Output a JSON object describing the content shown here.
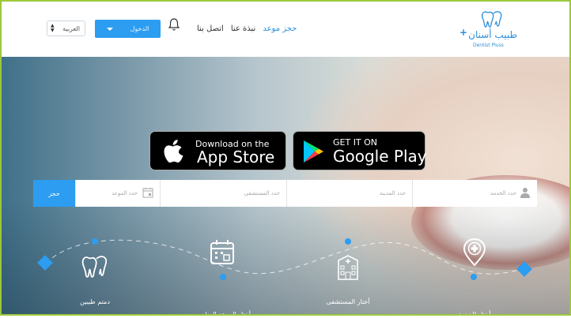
{
  "header": {
    "language_select": "العربية",
    "login_label": "الدخول",
    "nav": [
      "حجز موعد",
      "نبذة عنا",
      "اتصل بنا"
    ],
    "logo_title": "طبيب أسنان",
    "logo_subtitle": "Dentist Pluss"
  },
  "badges": {
    "apple_small": "Download on the",
    "apple_big": "App Store",
    "google_small": "GET IT ON",
    "google_big": "Google Play"
  },
  "search": {
    "service_placeholder": "حدد الخدمة",
    "city_placeholder": "حدد المدينة",
    "hospital_placeholder": "حدد المستشفى",
    "date_placeholder": "حدد الموعد",
    "book_label": "حجز"
  },
  "steps": [
    "دمتم طيبين",
    "أختار الموعد المناسب",
    "أختار المستشفى",
    "أختار الخدمة"
  ],
  "colors": {
    "accent": "#2c9df0",
    "frame": "#9bc83a"
  }
}
